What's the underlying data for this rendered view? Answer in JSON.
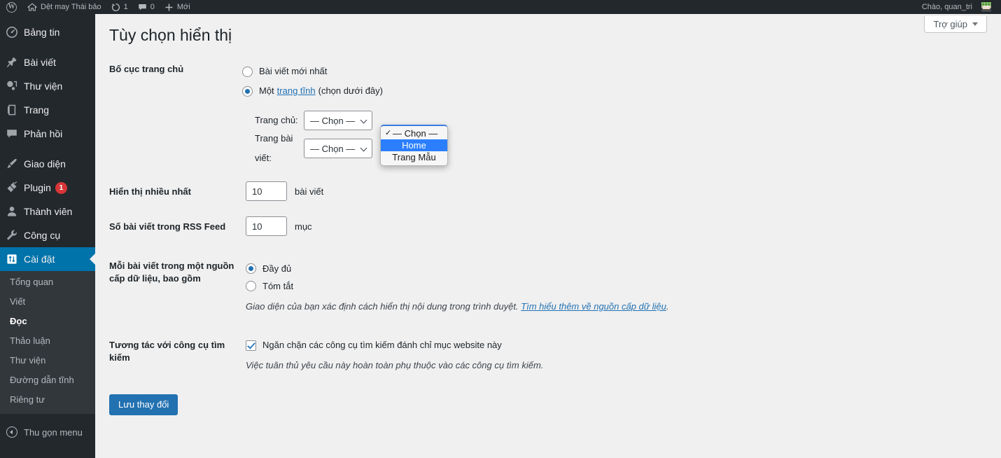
{
  "adminbar": {
    "logo_icon": "wordpress-logo-icon",
    "site_name": "Dệt may Thái bảo",
    "updates_icon": "updates-icon",
    "updates_count": "1",
    "comments_icon": "comments-icon",
    "comments_count": "0",
    "new_icon": "plus-icon",
    "new_label": "Mới",
    "howdy": "Chào, quan_tri",
    "avatar_icon": "user-avatar"
  },
  "sidebar": {
    "items": [
      {
        "label": "Bảng tin",
        "icon": "dashboard-icon",
        "current": false
      },
      {
        "label": "Bài viết",
        "icon": "pin-icon",
        "current": false
      },
      {
        "label": "Thư viện",
        "icon": "media-icon",
        "current": false
      },
      {
        "label": "Trang",
        "icon": "page-icon",
        "current": false
      },
      {
        "label": "Phản hồi",
        "icon": "comment-icon",
        "current": false
      },
      {
        "label": "Giao diện",
        "icon": "appearance-brush-icon",
        "current": false
      },
      {
        "label": "Plugin",
        "icon": "plugin-plug-icon",
        "current": false,
        "badge": "1"
      },
      {
        "label": "Thành viên",
        "icon": "users-icon",
        "current": false
      },
      {
        "label": "Công cụ",
        "icon": "tools-wrench-icon",
        "current": false
      },
      {
        "label": "Cài đặt",
        "icon": "settings-sliders-icon",
        "current": true
      }
    ],
    "submenu": [
      {
        "label": "Tổng quan",
        "current": false
      },
      {
        "label": "Viết",
        "current": false
      },
      {
        "label": "Đọc",
        "current": true
      },
      {
        "label": "Thảo luận",
        "current": false
      },
      {
        "label": "Thư viện",
        "current": false
      },
      {
        "label": "Đường dẫn tĩnh",
        "current": false
      },
      {
        "label": "Riêng tư",
        "current": false
      }
    ],
    "collapse_label": "Thu gọn menu",
    "collapse_icon": "collapse-arrow-icon"
  },
  "screen_meta": {
    "help_label": "Trợ giúp",
    "help_caret_icon": "caret-down-icon"
  },
  "page": {
    "title": "Tùy chọn hiển thị"
  },
  "front_page": {
    "label": "Bố cục trang chủ",
    "option_posts": "Bài viết mới nhất",
    "option_static_prefix": "Một",
    "option_static_link": "trang tĩnh",
    "option_static_suffix": "(chọn dưới đây)",
    "posts_selected": false,
    "static_selected": true,
    "homepage_label": "Trang chủ:",
    "homepage_value": "— Chọn —",
    "posts_page_label": "Trang bài viết:",
    "posts_page_value": "— Chọn —"
  },
  "dropdown": {
    "open": true,
    "check_icon": "check-mark-icon",
    "options": [
      {
        "label": "— Chọn —",
        "checked": true,
        "highlighted": false
      },
      {
        "label": "Home",
        "checked": false,
        "highlighted": true
      },
      {
        "label": "Trang Mẫu",
        "checked": false,
        "highlighted": false
      }
    ]
  },
  "posts_per_page": {
    "label": "Hiển thị nhiều nhất",
    "value": "10",
    "unit": "bài viết"
  },
  "rss_items": {
    "label": "Số bài viết trong RSS Feed",
    "value": "10",
    "unit": "mục"
  },
  "feed_content": {
    "label": "Mỗi bài viết trong một nguồn cấp dữ liệu, bao gồm",
    "option_full": "Đầy đủ",
    "option_summary": "Tóm tắt",
    "full_selected": true,
    "summary_selected": false,
    "description_text": "Giao diện của bạn xác định cách hiển thị nội dung trong trình duyệt.",
    "description_link": "Tìm hiểu thêm về nguồn cấp dữ liệu",
    "description_end": "."
  },
  "search_visibility": {
    "label": "Tương tác với công cụ tìm kiếm",
    "checkbox_label": "Ngăn chặn các công cụ tìm kiếm đánh chỉ mục website này",
    "checked": true,
    "description": "Việc tuân thủ yêu cầu này hoàn toàn phụ thuộc vào các công cụ tìm kiếm."
  },
  "submit": {
    "label": "Lưu thay đổi"
  },
  "colors": {
    "accent": "#2271b1",
    "menu_bg": "#23282d",
    "submenu_bg": "#32373c",
    "current_menu": "#0073aa",
    "badge": "#d63638",
    "content_bg": "#f0f0f1",
    "dropdown_highlight": "#2b7fff"
  }
}
